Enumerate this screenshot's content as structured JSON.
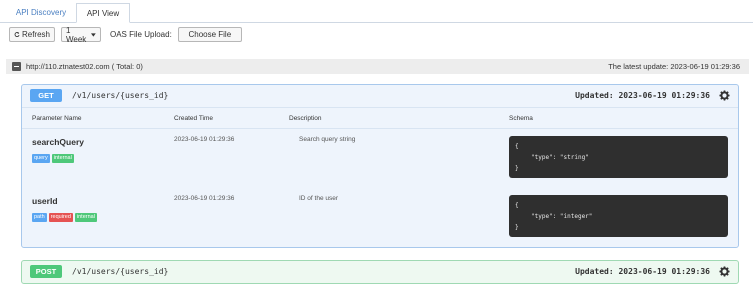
{
  "tabs": [
    {
      "label": "API Discovery"
    },
    {
      "label": "API View"
    }
  ],
  "toolbar": {
    "refresh_label": "Refresh",
    "period_label": "1 Week",
    "oas_label": "OAS File Upload:",
    "choose_label": "Choose File"
  },
  "host": {
    "url": "http://110.ztnatest02.com ( Total: 0)",
    "latest_update": "The latest update: 2023-06-19 01:29:36"
  },
  "endpoints": [
    {
      "method": "GET",
      "path": "/v1/users/{users_id}",
      "updated": "Updated: 2023-06-19 01:29:36",
      "columns": [
        "Parameter Name",
        "Created Time",
        "Description",
        "Schema"
      ],
      "params": [
        {
          "name": "searchQuery",
          "created": "2023-06-19 01:29:36",
          "description": "Search query string",
          "tags": [
            {
              "label": "query",
              "color": "#5aa6f2"
            },
            {
              "label": "internal",
              "color": "#4ec87a"
            }
          ],
          "schema": {
            "open": "{",
            "line": "\"type\": \"string\"",
            "close": "}"
          }
        },
        {
          "name": "userId",
          "created": "2023-06-19 01:29:36",
          "description": "ID of the user",
          "tags": [
            {
              "label": "path",
              "color": "#5aa6f2"
            },
            {
              "label": "required",
              "color": "#e55353"
            },
            {
              "label": "internal",
              "color": "#4ec87a"
            }
          ],
          "schema": {
            "open": "{",
            "line": "\"type\": \"integer\"",
            "close": "}"
          }
        }
      ]
    },
    {
      "method": "POST",
      "path": "/v1/users/{users_id}",
      "updated": "Updated: 2023-06-19 01:29:36"
    }
  ]
}
